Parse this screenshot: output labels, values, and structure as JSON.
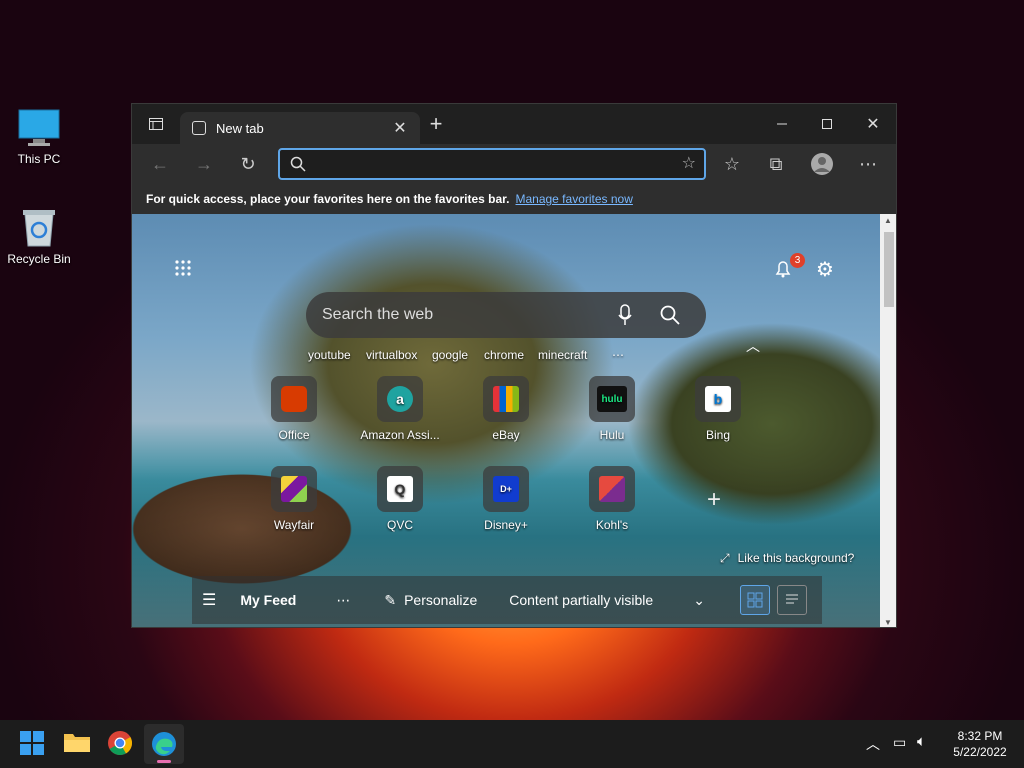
{
  "desktop": {
    "icons": [
      {
        "label": "This PC",
        "icon": "monitor-icon"
      },
      {
        "label": "Recycle Bin",
        "icon": "recycle-bin-icon"
      }
    ]
  },
  "browser": {
    "tab": {
      "title": "New tab"
    },
    "favorites_bar": {
      "text": "For quick access, place your favorites here on the favorites bar.",
      "link": "Manage favorites now"
    },
    "newtab": {
      "notification_count": "3",
      "search_placeholder": "Search the web",
      "suggestions": [
        "youtube",
        "virtualbox",
        "google",
        "chrome",
        "minecraft",
        "⋯"
      ],
      "tiles_row1": [
        {
          "label": "Office",
          "icon": "office-icon",
          "color": "#d83b01"
        },
        {
          "label": "Amazon Assi...",
          "icon": "amazon-assistant-icon",
          "color": "#1fa3a0"
        },
        {
          "label": "eBay",
          "icon": "ebay-icon",
          "color": "#e53238"
        },
        {
          "label": "Hulu",
          "icon": "hulu-icon",
          "color": "#1ce783"
        },
        {
          "label": "Bing",
          "icon": "bing-icon",
          "color": "#0078d4"
        }
      ],
      "tiles_row2": [
        {
          "label": "Wayfair",
          "icon": "wayfair-icon",
          "color": "#7b189f"
        },
        {
          "label": "QVC",
          "icon": "qvc-icon",
          "color": "#ffffff"
        },
        {
          "label": "Disney+",
          "icon": "disney-plus-icon",
          "color": "#113ccf"
        },
        {
          "label": "Kohl's",
          "icon": "kohls-icon",
          "color": "#e64a3f"
        }
      ],
      "hulu_text": "hulu",
      "like_background": "Like this background?",
      "feed": {
        "my_feed": "My Feed",
        "more": "⋯",
        "personalize": "Personalize",
        "content_visibility": "Content partially visible"
      }
    }
  },
  "taskbar": {
    "time": "8:32 PM",
    "date": "5/22/2022"
  }
}
